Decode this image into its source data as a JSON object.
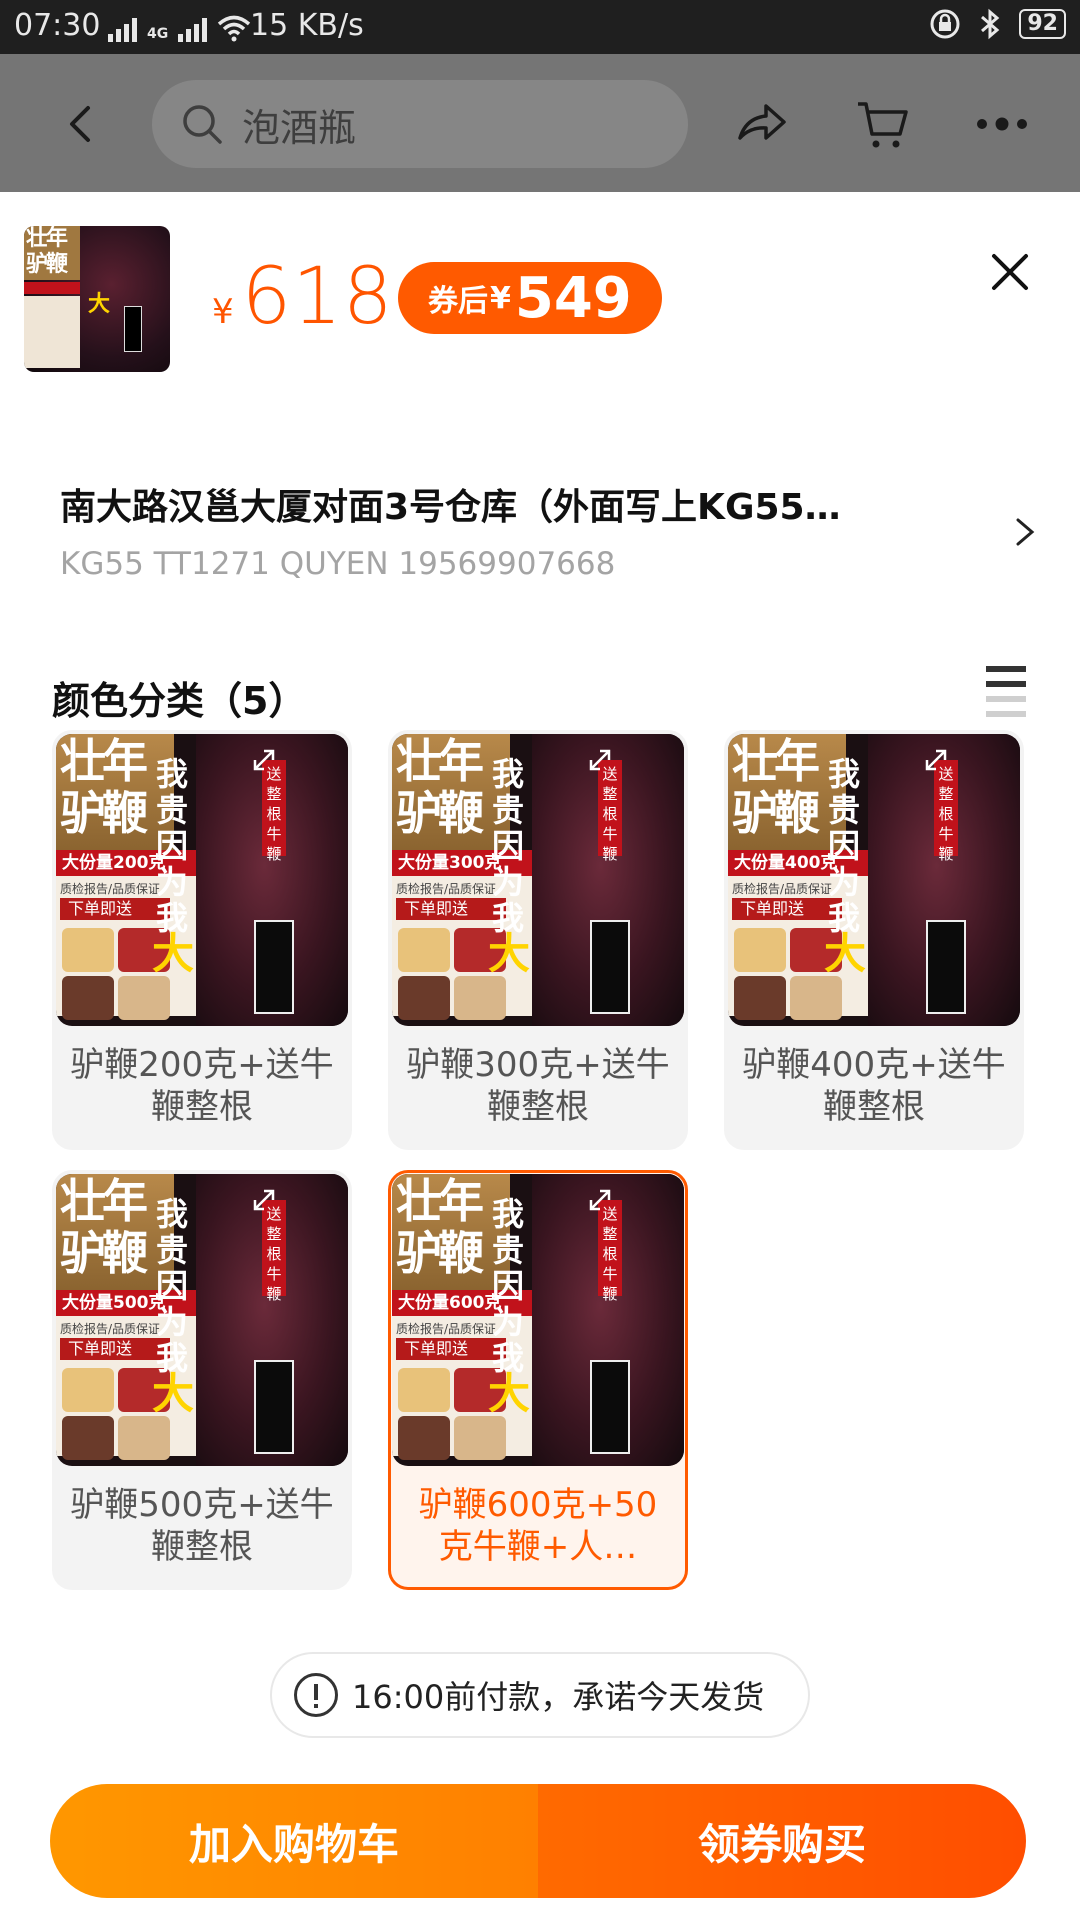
{
  "status_bar": {
    "time": "07:30",
    "network": "4G",
    "speed": "15 KB/s",
    "battery": "92"
  },
  "nav": {
    "search_placeholder": "泡酒瓶",
    "icons": [
      "back-icon",
      "search-icon",
      "share-icon",
      "cart-icon",
      "more-icon"
    ]
  },
  "sku": {
    "currency": "¥",
    "price": "618",
    "coupon_label": "券后",
    "coupon_currency": "¥",
    "coupon_price": "549"
  },
  "address": {
    "line1": "南大路汉邕大厦对面3号仓库（外面写上KG55…",
    "line2": "KG55 TT1271 QUYEN 19569907668"
  },
  "variants_title": "颜色分类（5）",
  "variants": [
    {
      "name": "驴鞭200克+送牛鞭整根",
      "weight_tag": "大份量200克",
      "selected": false
    },
    {
      "name": "驴鞭300克+送牛鞭整根",
      "weight_tag": "大份量300克",
      "selected": false
    },
    {
      "name": "驴鞭400克+送牛鞭整根",
      "weight_tag": "大份量400克",
      "selected": false
    },
    {
      "name": "驴鞭500克+送牛鞭整根",
      "weight_tag": "大份量500克",
      "selected": false
    },
    {
      "name": "驴鞭600克+50克牛鞭+人…",
      "weight_tag": "大份量600克",
      "selected": true
    }
  ],
  "product_image_text": {
    "title_top": "壮年",
    "title_bottom": "驴鞭",
    "quality": "质检报告/品质保证",
    "order_gift": "下单即送",
    "slogan": "我贵因为我",
    "slogan_big": "大",
    "side_tag": "送整根牛鞭"
  },
  "notice": "16:00前付款，承诺今天发货",
  "buttons": {
    "add_to_cart": "加入购物车",
    "buy": "领券购买"
  },
  "colors": {
    "accent": "#ff5500",
    "cart_button": "#ff8a00",
    "buy_button": "#ff5a00"
  }
}
